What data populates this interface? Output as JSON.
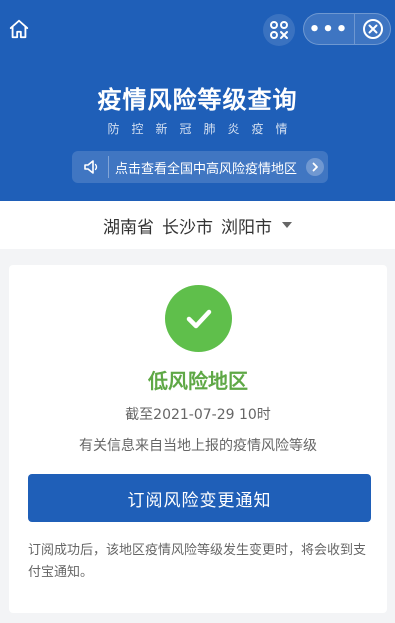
{
  "header": {
    "title": "疫情风险等级查询",
    "subtitle": "防控新冠肺炎疫情",
    "notice": "点击查看全国中高风险疫情地区",
    "more_label": "•••"
  },
  "location": {
    "province": "湖南省",
    "city": "长沙市",
    "district": "浏阳市"
  },
  "result": {
    "level": "低风险地区",
    "as_of": "截至2021-07-29 10时",
    "source_note": "有关信息来自当地上报的疫情风险等级",
    "subscribe_label": "订阅风险变更通知",
    "footnote": "订阅成功后，该地区疫情风险等级发生变更时，将会收到支付宝通知。"
  },
  "colors": {
    "primary": "#1f5fb8",
    "success": "#5fbf4b",
    "success_text": "#5fa846"
  },
  "icons": [
    "home-icon",
    "scan-icon",
    "more-icon",
    "close-icon",
    "speaker-icon",
    "chevron-right-icon",
    "caret-down-icon",
    "check-icon"
  ]
}
